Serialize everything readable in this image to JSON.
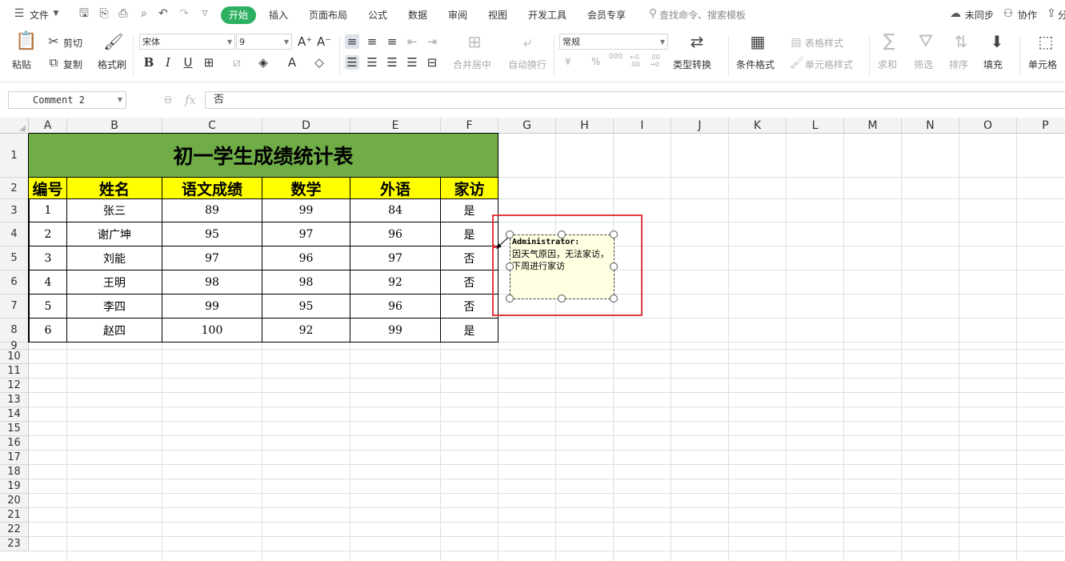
{
  "menubar": {
    "menu_label": "文件",
    "tabs": [
      "开始",
      "插入",
      "页面布局",
      "公式",
      "数据",
      "审阅",
      "视图",
      "开发工具",
      "会员专享"
    ],
    "search_placeholder": "查找命令、搜索模板",
    "sync_label": "未同步",
    "collab_label": "协作",
    "share_label": "分"
  },
  "ribbon": {
    "paste": "粘贴",
    "cut": "剪切",
    "copy": "复制",
    "format_painter": "格式刷",
    "font_name": "宋体",
    "font_size": "9",
    "bold": "B",
    "italic": "I",
    "underline": "U",
    "number_format": "常规",
    "merge_center": "合并居中",
    "auto_wrap": "自动换行",
    "type_convert": "类型转换",
    "cond_format": "条件格式",
    "table_style": "表格样式",
    "cell_style": "单元格样式",
    "sum": "求和",
    "filter": "筛选",
    "sort": "排序",
    "fill": "填充",
    "cell": "单元格",
    "currency": "¥",
    "percent": "%",
    "thousands": "000",
    "dec_inc": "←0 .00",
    "dec_dec": ".00 →0"
  },
  "formula_bar": {
    "name_box": "Comment 2",
    "fx": "fx",
    "content": "否"
  },
  "columns": [
    "A",
    "B",
    "C",
    "D",
    "E",
    "F",
    "G",
    "H",
    "I",
    "J",
    "K",
    "L",
    "M",
    "N",
    "O",
    "P"
  ],
  "rows": [
    "1",
    "2",
    "3",
    "4",
    "5",
    "6",
    "7",
    "8",
    "9",
    "10",
    "11",
    "12",
    "13",
    "14",
    "15",
    "16",
    "17",
    "18",
    "19",
    "20",
    "21",
    "22",
    "23"
  ],
  "table": {
    "title": "初一学生成绩统计表",
    "headers": [
      "编号",
      "姓名",
      "语文成绩",
      "数学",
      "外语",
      "家访"
    ],
    "data": [
      [
        "1",
        "张三",
        "89",
        "99",
        "84",
        "是"
      ],
      [
        "2",
        "谢广坤",
        "95",
        "97",
        "96",
        "是"
      ],
      [
        "3",
        "刘能",
        "97",
        "96",
        "97",
        "否"
      ],
      [
        "4",
        "王明",
        "98",
        "98",
        "92",
        "否"
      ],
      [
        "5",
        "李四",
        "99",
        "95",
        "96",
        "否"
      ],
      [
        "6",
        "赵四",
        "100",
        "92",
        "99",
        "是"
      ]
    ]
  },
  "comment": {
    "author": "Administrator:",
    "line1": "因天气原因，无法家访，",
    "line2": "下周进行家访"
  },
  "colors": {
    "title_fill": "#70ad47",
    "header_fill": "#ffff00",
    "comment_fill": "#ffffe1",
    "highlight_box": "#e0393e",
    "active_tab": "#2eb062"
  }
}
